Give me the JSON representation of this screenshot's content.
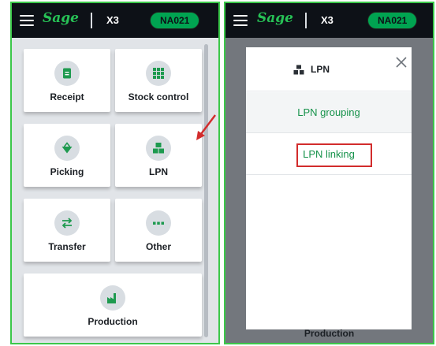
{
  "brand": "Sage",
  "module": "X3",
  "folder": "NA021",
  "colors": {
    "topbar": "#0d1117",
    "brand_green": "#27c256",
    "folder_badge": "#00a451",
    "frame_border": "#3cc84a",
    "link_green": "#16924a",
    "annotation_red": "#d22c2c"
  },
  "menu": {
    "tiles": [
      {
        "label": "Receipt",
        "icon": "receipt-icon"
      },
      {
        "label": "Stock control",
        "icon": "grid-icon"
      },
      {
        "label": "Picking",
        "icon": "basket-icon"
      },
      {
        "label": "LPN",
        "icon": "boxes-icon"
      },
      {
        "label": "Transfer",
        "icon": "transfer-arrows-icon"
      },
      {
        "label": "Other",
        "icon": "more-dots-icon"
      },
      {
        "label": "Production",
        "icon": "factory-icon"
      }
    ]
  },
  "lpn_dialog": {
    "title": "LPN",
    "icon": "boxes-icon",
    "options": [
      "LPN grouping",
      "LPN linking"
    ],
    "highlighted_option": "LPN linking",
    "background_tile_label": "Production"
  },
  "annotations": {
    "arrow": "red-arrow-icon",
    "highlight_box": "red-box"
  }
}
